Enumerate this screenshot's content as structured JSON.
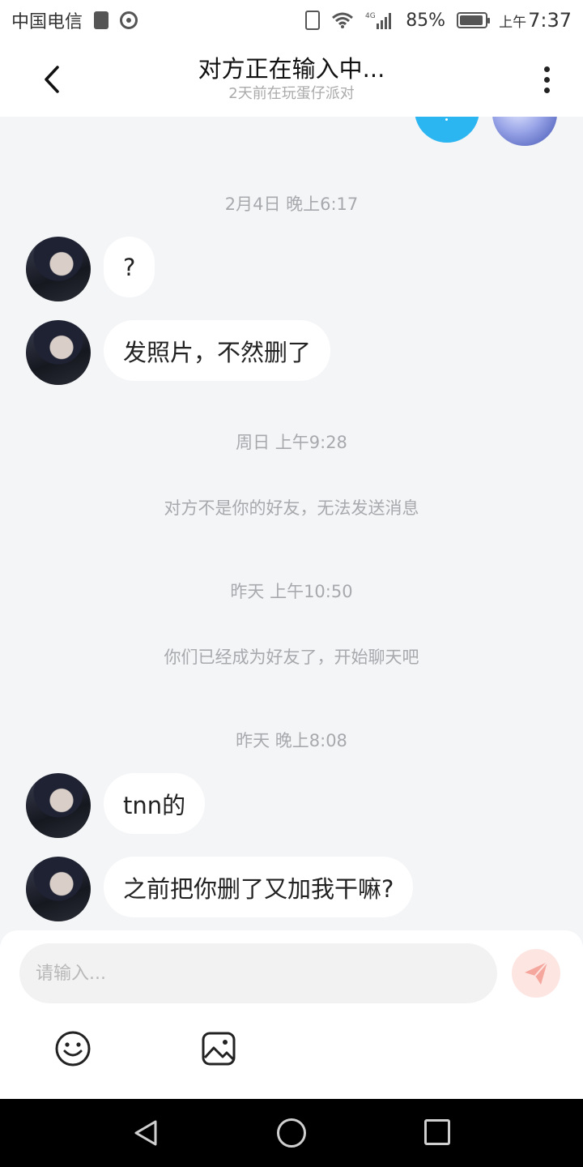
{
  "status_bar": {
    "carrier": "中国电信",
    "battery_percent": "85%",
    "ampm": "上午",
    "time": "7:37",
    "network": "4G"
  },
  "header": {
    "title": "对方正在输入中...",
    "subtitle": "2天前在玩蛋仔派对"
  },
  "messages": [
    {
      "type": "time",
      "text": "2月4日 晚上6:17"
    },
    {
      "type": "incoming",
      "text": "?"
    },
    {
      "type": "incoming",
      "text": "发照片，不然删了"
    },
    {
      "type": "time",
      "text": "周日 上午9:28"
    },
    {
      "type": "system",
      "text": "对方不是你的好友，无法发送消息"
    },
    {
      "type": "time",
      "text": "昨天 上午10:50"
    },
    {
      "type": "system",
      "text": "你们已经成为好友了，开始聊天吧"
    },
    {
      "type": "time",
      "text": "昨天 晚上8:08"
    },
    {
      "type": "incoming",
      "text": "tnn的"
    },
    {
      "type": "incoming",
      "text": "之前把你删了又加我干嘛?"
    }
  ],
  "input": {
    "placeholder": "请输入...",
    "value": ""
  },
  "colors": {
    "chat_background": "#f4f5f7",
    "send_button": "#fde5e2",
    "send_icon": "#f5a79d",
    "timestamp_text": "#a7a9ad",
    "partial_bubble": "#2bb6f2"
  },
  "icons": {
    "back": "back-chevron-icon",
    "more": "more-vertical-icon",
    "send": "paper-plane-icon",
    "emoji": "smiley-icon",
    "image": "image-icon",
    "nav_back": "triangle-back-icon",
    "nav_home": "circle-home-icon",
    "nav_recent": "square-recent-icon"
  }
}
